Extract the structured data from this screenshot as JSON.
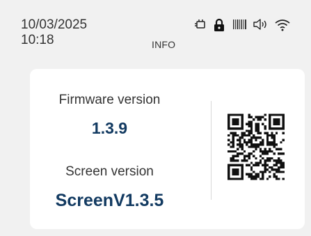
{
  "status_bar": {
    "date": "10/03/2025",
    "time": "10:18",
    "title": "INFO",
    "icons": [
      "charging-icon",
      "lock-icon",
      "barcode-icon",
      "speaker-icon",
      "wifi-icon"
    ]
  },
  "info": {
    "firmware_label": "Firmware version",
    "firmware_value": "1.3.9",
    "screen_label": "Screen version",
    "screen_value": "ScreenV1.3.5"
  },
  "colors": {
    "background": "#f1f1f1",
    "card": "#ffffff",
    "value_text": "#123a61",
    "label_text": "#333333"
  }
}
